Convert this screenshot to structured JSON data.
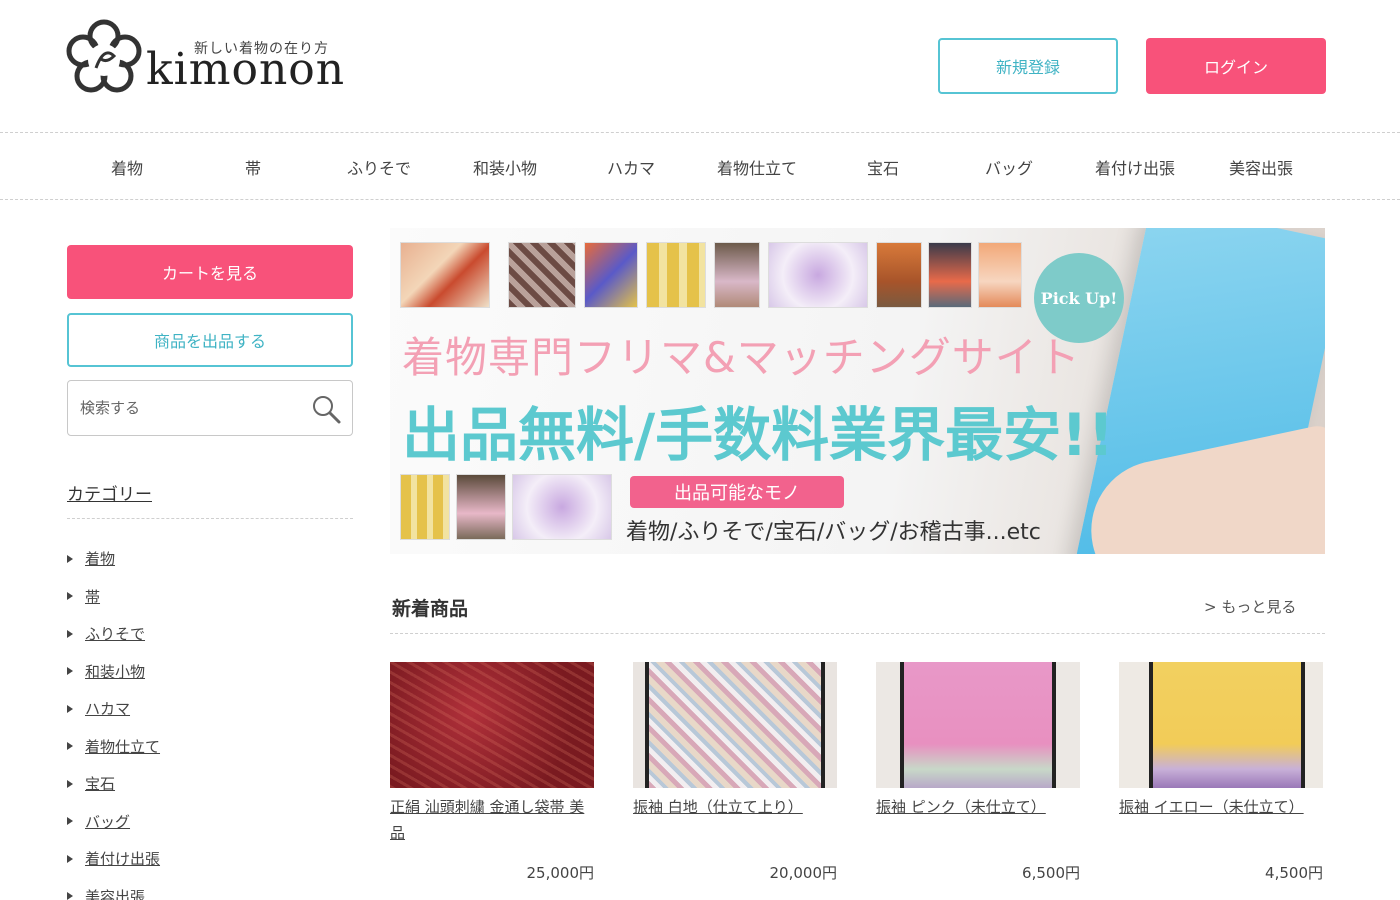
{
  "header": {
    "logo_tagline": "新しい着物の在り方",
    "logo_word": "kimonon",
    "register_label": "新規登録",
    "login_label": "ログイン"
  },
  "nav": {
    "items": [
      "着物",
      "帯",
      "ふりそで",
      "和装小物",
      "ハカマ",
      "着物仕立て",
      "宝石",
      "バッグ",
      "着付け出張",
      "美容出張"
    ]
  },
  "sidebar": {
    "cart_label": "カートを見る",
    "sell_label": "商品を出品する",
    "search_placeholder": "検索する",
    "category_heading": "カテゴリー",
    "categories": [
      "着物",
      "帯",
      "ふりそで",
      "和装小物",
      "ハカマ",
      "着物仕立て",
      "宝石",
      "バッグ",
      "着付け出張",
      "美容出張"
    ]
  },
  "banner": {
    "pickup": "Pick Up!",
    "line1": "着物専門フリマ&マッチングサイト",
    "line2": "出品無料/手数料業界最安!!",
    "badge": "出品可能なモノ",
    "line3": "着物/ふりそで/宝石/バッグ/お稽古事...etc"
  },
  "new_items": {
    "title": "新着商品",
    "more_label": "> もっと見る",
    "products": [
      {
        "name": "正絹 汕頭刺繍 金通し袋帯 美品",
        "price": "25,000円"
      },
      {
        "name": "振袖 白地（仕立て上り）",
        "price": "20,000円"
      },
      {
        "name": "振袖 ピンク（未仕立て）",
        "price": "6,500円"
      },
      {
        "name": "振袖 イエロー（未仕立て）",
        "price": "4,500円"
      }
    ]
  },
  "colors": {
    "accent_pink": "#f8527a",
    "accent_teal": "#56c4d4"
  }
}
